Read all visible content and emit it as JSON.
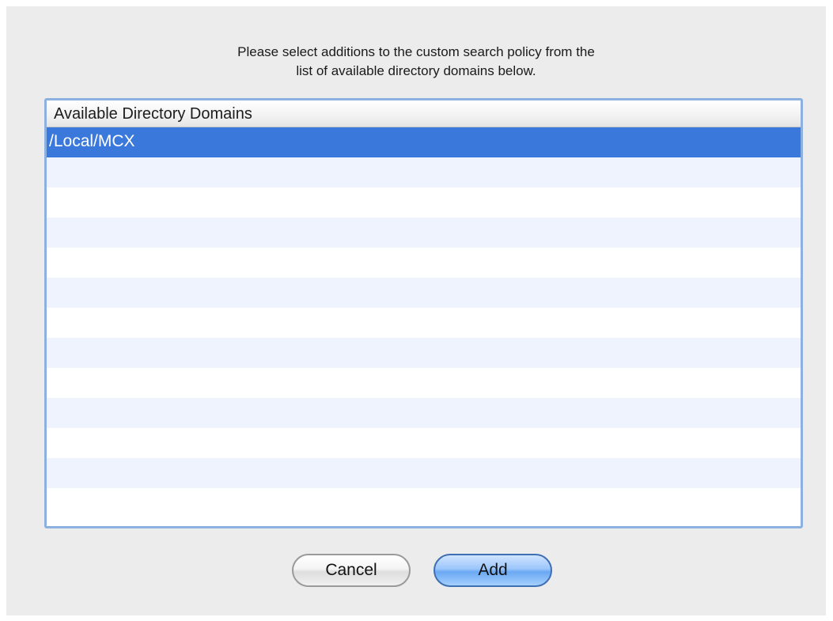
{
  "dialog": {
    "prompt_lines": [
      "Please select additions to the custom search policy from the",
      "list of available directory domains below."
    ]
  },
  "list": {
    "header": "Available Directory Domains",
    "items": [
      {
        "label": "/Local/MCX",
        "selected": true
      }
    ],
    "empty_rows": 12
  },
  "buttons": {
    "cancel_label": "Cancel",
    "add_label": "Add"
  },
  "colors": {
    "selection": "#3a79db",
    "stripe": "#eef3fd",
    "focus_ring": "#8cb0e0",
    "default_button": "#6aa8f3"
  }
}
